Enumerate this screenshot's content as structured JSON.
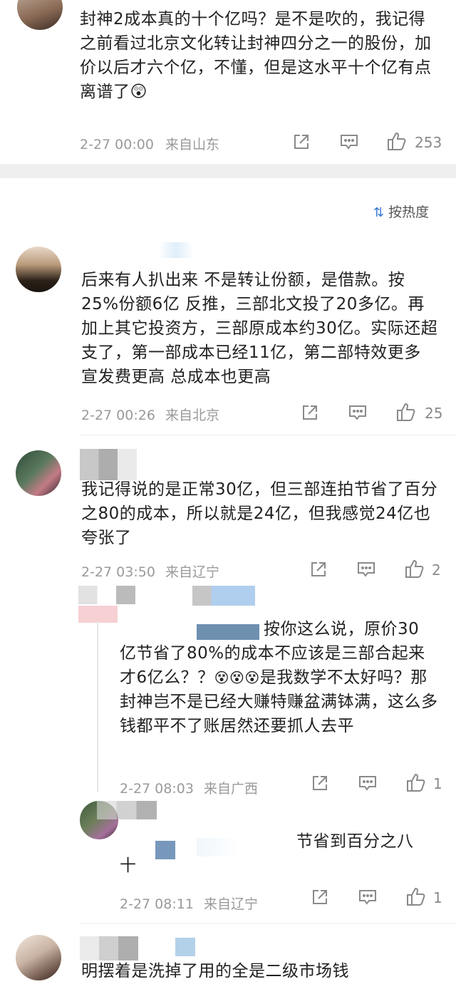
{
  "comments": [
    {
      "text": "封神2成本真的十个亿吗？是不是吹的，我记得之前看过北京文化转让封神四分之一的股份，加价以后才六个亿，不懂，但是这水平十个亿有点离谱了",
      "emoji": "😲",
      "date": "2-27 00:00",
      "location": "来自山东",
      "likes": "253"
    },
    {
      "text": "后来有人扒出来 不是转让份额，是借款。按25%份额6亿 反推，三部北文投了20多亿。再加上其它投资方，三部原成本约30亿。实际还超支了，第一部成本已经11亿，第二部特效更多 宣发费更高 总成本也更高",
      "date": "2-27 00:26",
      "location": "来自北京",
      "likes": "25"
    },
    {
      "text": "我记得说的是正常30亿，但三部连拍节省了百分之80的成本，所以就是24亿，但我感觉24亿也夸张了",
      "date": "2-27 03:50",
      "location": "来自辽宁",
      "likes": "2"
    },
    {
      "text_line1": "按你这么说，原价30",
      "text_rest": "亿节省了80%的成本不应该是三部合起来才6亿么？？",
      "emojis": "😵😵😵",
      "text_after": "是我数学不太好吗？那封神岂不是已经大赚特赚盆满钵满，这么多钱都平不了账居然还要抓人去平",
      "date": "2-27 08:03",
      "location": "来自广西",
      "likes": "1"
    },
    {
      "text_line1": "节省到百分之八",
      "text_line2": "十",
      "date": "2-27 08:11",
      "location": "来自辽宁",
      "likes": "1"
    },
    {
      "text": "明摆着是洗掉了用的全是二级市场钱"
    }
  ],
  "sort": {
    "label": "按热度"
  },
  "colors": {
    "meta": "#9a9a9a",
    "text": "#222222",
    "band": "#efefef"
  },
  "icons": {
    "share": "share-icon",
    "comment": "comment-icon",
    "like": "thumbs-up-icon",
    "sort": "sort-icon"
  }
}
